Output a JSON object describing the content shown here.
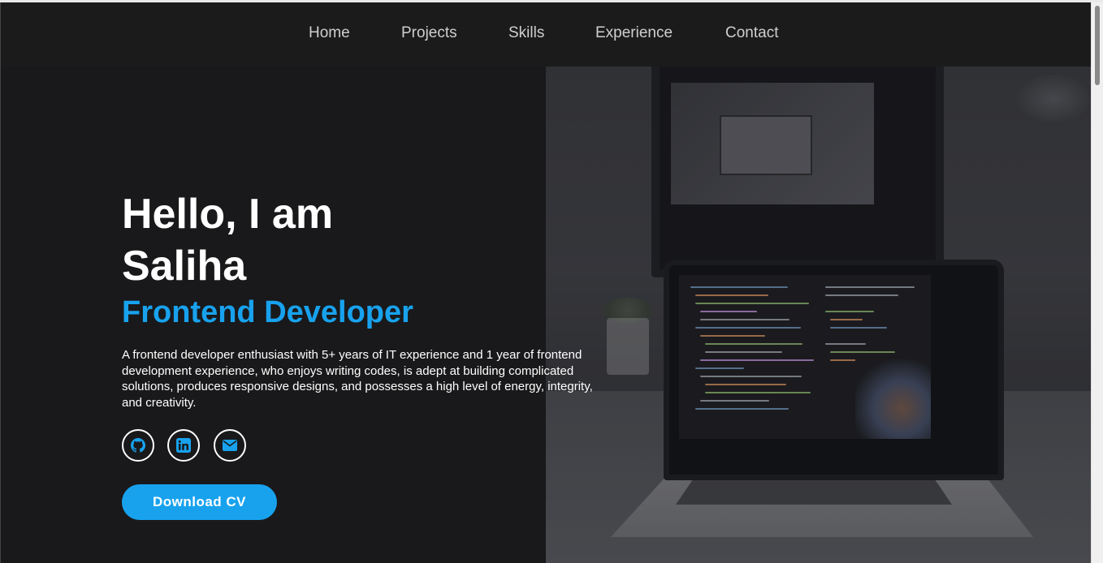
{
  "nav": {
    "items": [
      {
        "label": "Home"
      },
      {
        "label": "Projects"
      },
      {
        "label": "Skills"
      },
      {
        "label": "Experience"
      },
      {
        "label": "Contact"
      }
    ]
  },
  "hero": {
    "greeting_line1": "Hello, I am",
    "greeting_line2": "Saliha",
    "role": "Frontend Developer",
    "bio": "A frontend developer enthusiast with 5+ years of IT experience and 1 year of frontend development experience, who enjoys writing codes, is adept at building complicated solutions, produces responsive designs, and possesses a high level of energy, integrity, and creativity.",
    "social": [
      {
        "icon": "github-icon"
      },
      {
        "icon": "linkedin-icon"
      },
      {
        "icon": "envelope-icon"
      }
    ],
    "cta_label": "Download CV"
  },
  "colors": {
    "accent": "#18a2ee",
    "background": "#19191b",
    "nav_text": "#cfcfcf"
  }
}
